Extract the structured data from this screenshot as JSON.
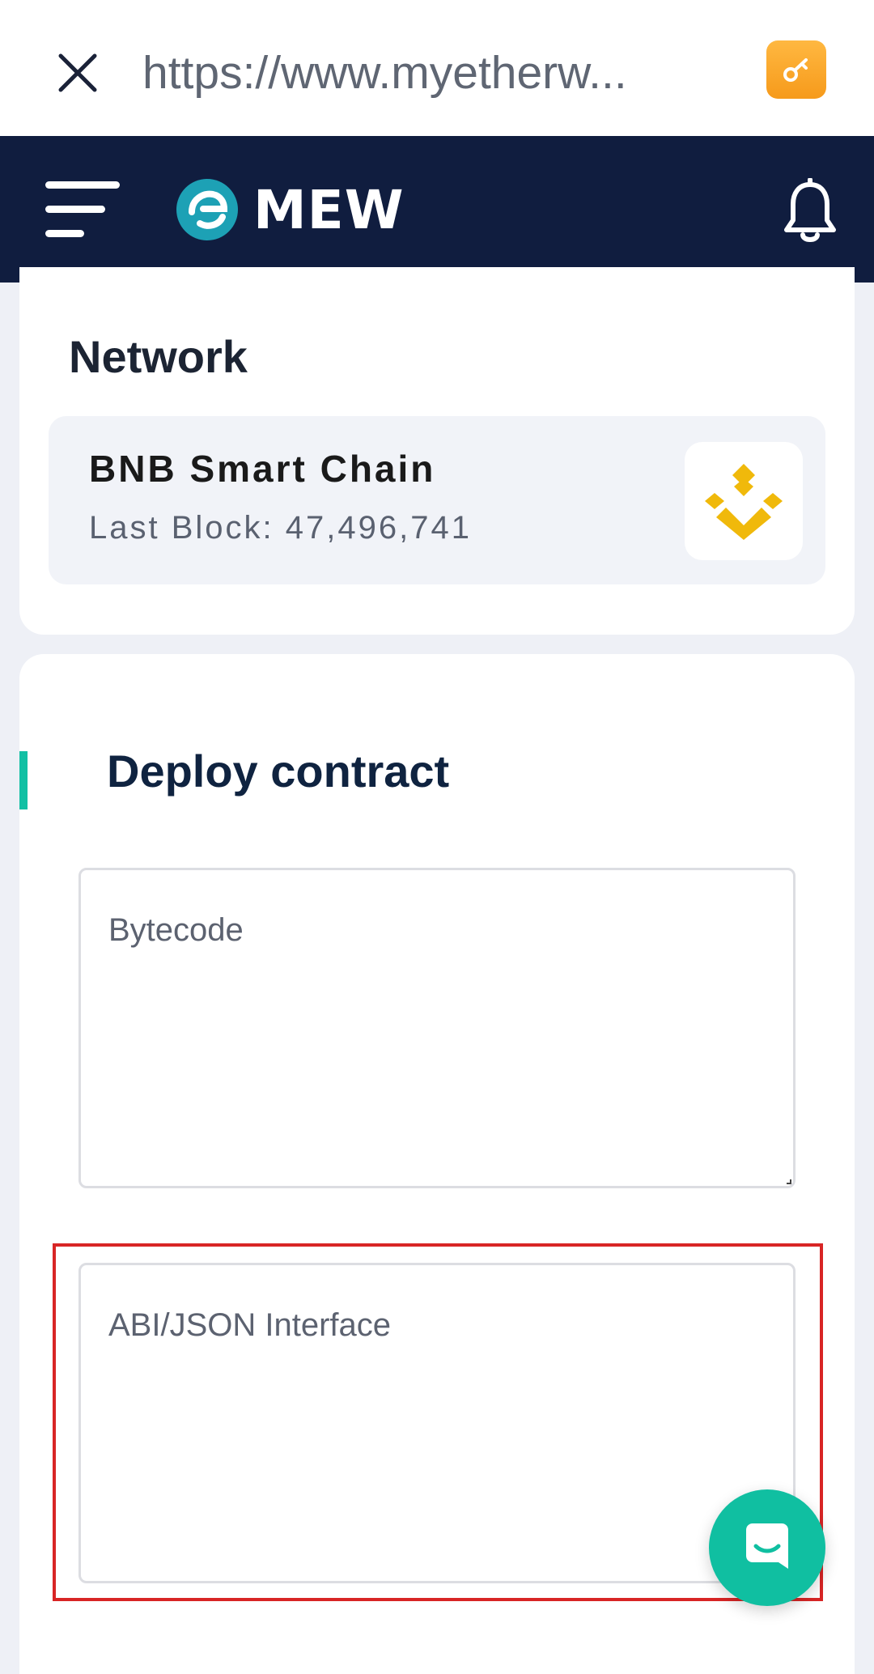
{
  "browser": {
    "url": "https://www.myetherw...",
    "close_icon": "close-icon",
    "key_icon": "key-icon",
    "key_color": "#f8a52a"
  },
  "header": {
    "logo_text": "MEW",
    "menu_icon": "hamburger-menu-icon",
    "bell_icon": "bell-icon",
    "background": "#101d3f",
    "logo_color": "#1da1b5"
  },
  "network": {
    "title": "Network",
    "name": "BNB Smart Chain",
    "last_block": "Last Block: 47,496,741",
    "icon": "bnb-logo-icon",
    "icon_color": "#f0b90b"
  },
  "deploy": {
    "title": "Deploy contract",
    "bytecode_placeholder": "Bytecode",
    "abi_placeholder": "ABI/JSON Interface",
    "accent_color": "#12c0a4"
  },
  "chat": {
    "icon": "chat-icon",
    "color": "#10bfa1"
  },
  "highlight": {
    "color": "#d82525"
  }
}
